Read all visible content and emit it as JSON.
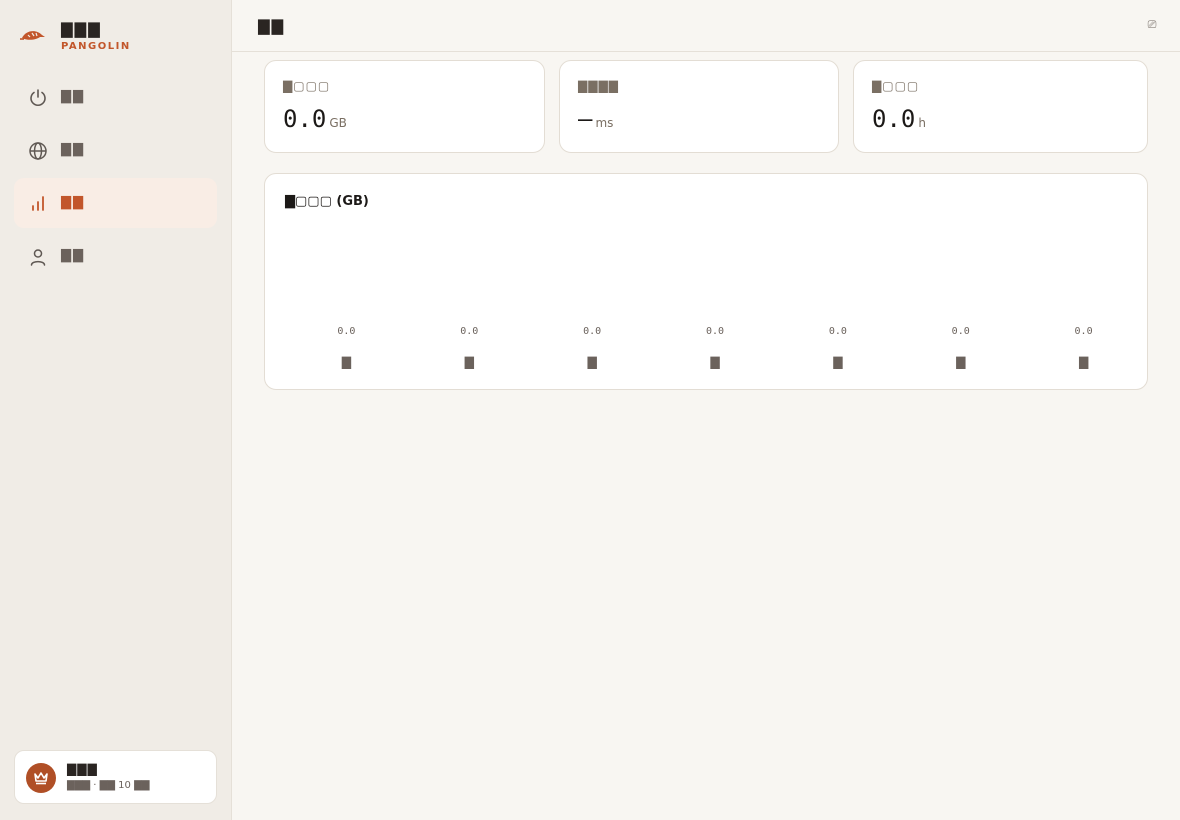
{
  "brand": {
    "name": "▇▇▇",
    "subtitle": "PANGOLIN",
    "accent": "#c2562b"
  },
  "nav": [
    {
      "label": "▇▇",
      "icon": "power-icon",
      "active": false
    },
    {
      "label": "▇▇",
      "icon": "globe-icon",
      "active": false
    },
    {
      "label": "▇▇",
      "icon": "bar-chart-icon",
      "active": true
    },
    {
      "label": "▇▇",
      "icon": "user-icon",
      "active": false
    }
  ],
  "account": {
    "name": "▇▇▇",
    "detail": "▇▇▇ · ▇▇ 10 ▇▇",
    "icon": "crown-icon"
  },
  "topbar": {
    "title": "▇▇",
    "action_icon": "refresh-icon",
    "action_glyph": "⎚"
  },
  "stats": [
    {
      "label": "▇▢▢▢",
      "value": "0.0",
      "unit": "GB"
    },
    {
      "label": "▇▇▇▇",
      "value": "—",
      "unit": "ms"
    },
    {
      "label": "▇▢▢▢",
      "value": "0.0",
      "unit": "h"
    }
  ],
  "chart": {
    "title": "▇▢▢▢ (GB)"
  },
  "chart_data": {
    "type": "bar",
    "categories": [
      "▇",
      "▇",
      "▇",
      "▇",
      "▇",
      "▇",
      "▇"
    ],
    "values": [
      0.0,
      0.0,
      0.0,
      0.0,
      0.0,
      0.0,
      0.0
    ],
    "value_labels": [
      "0.0",
      "0.0",
      "0.0",
      "0.0",
      "0.0",
      "0.0",
      "0.0"
    ],
    "title": "▇▢▢▢ (GB)",
    "xlabel": "",
    "ylabel": "",
    "grid": false,
    "bar_color": "#c2562b"
  }
}
